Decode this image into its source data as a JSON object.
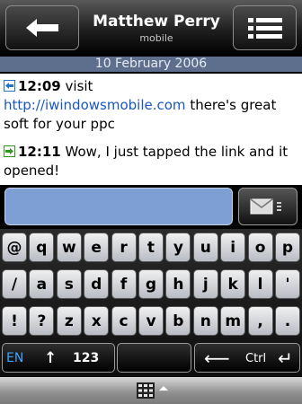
{
  "header": {
    "contact_name": "Matthew Perry",
    "contact_subtitle": "mobile",
    "back_icon": "back-arrow-icon",
    "menu_icon": "menu-list-icon"
  },
  "conversation": {
    "date": "10 February 2006",
    "messages": [
      {
        "direction": "incoming",
        "time": "12:09",
        "text_before": "visit",
        "link": "http://iwindowsmobile.com",
        "text_after": "there's great soft for your ppc"
      },
      {
        "direction": "outgoing",
        "time": "12:11",
        "text": "Wow, I just tapped the link and it opened!"
      }
    ]
  },
  "composer": {
    "input_value": "",
    "send_icon": "envelope-send-icon"
  },
  "keyboard": {
    "rows": [
      [
        "@",
        "q",
        "w",
        "e",
        "r",
        "t",
        "y",
        "u",
        "i",
        "o",
        "p"
      ],
      [
        "/",
        "a",
        "s",
        "d",
        "f",
        "g",
        "h",
        "j",
        "k",
        "l",
        "'"
      ],
      [
        "!",
        "?",
        "z",
        "x",
        "c",
        "v",
        "b",
        "n",
        "m",
        ",",
        "."
      ]
    ],
    "lang_label": "EN",
    "shift_symbol": "↑",
    "num_label": "123",
    "ctrl_label": "Ctrl",
    "backspace_symbol": "⟵",
    "enter_symbol": "↵"
  },
  "colors": {
    "date_bar": "#5d6f8c",
    "link": "#1a57c0",
    "incoming_arrow": "#1f74c9",
    "outgoing_arrow": "#2f9a1a",
    "input_bg": "#7d9fd4"
  }
}
